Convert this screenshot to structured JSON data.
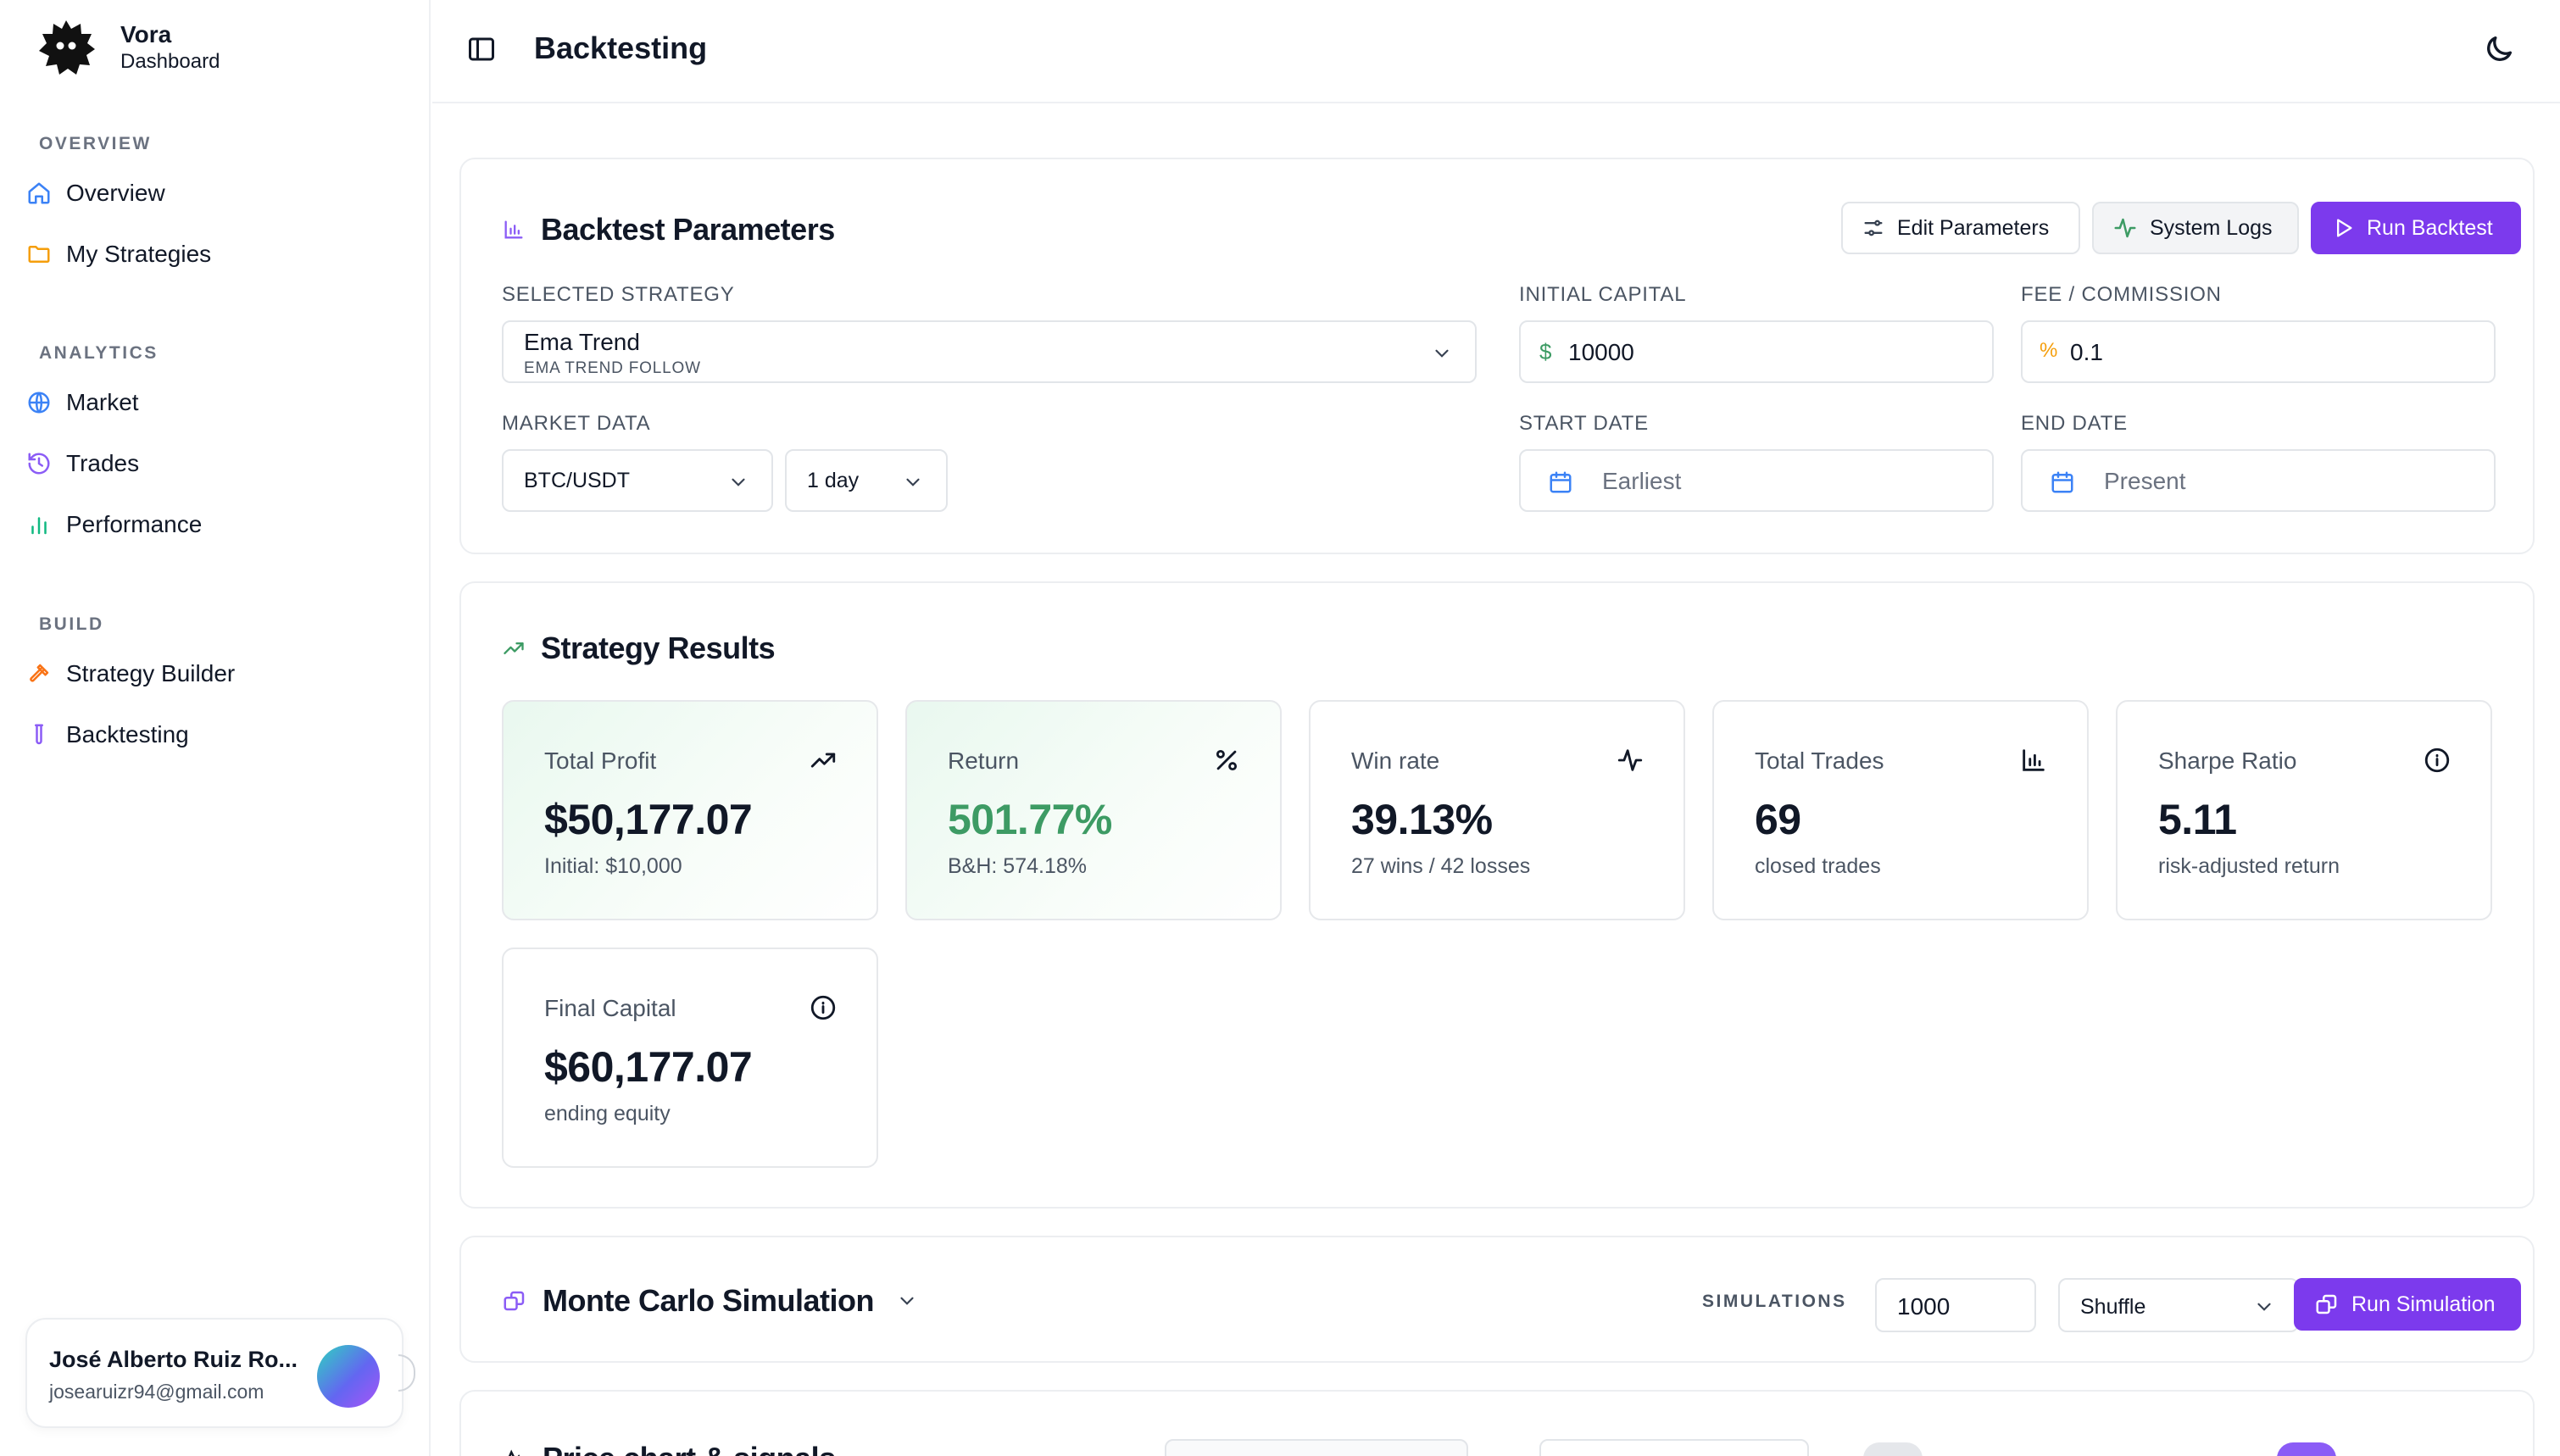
{
  "brand": {
    "name": "Vora",
    "subtitle": "Dashboard"
  },
  "sidebar": {
    "sections": [
      {
        "heading": "OVERVIEW",
        "items": [
          {
            "label": "Overview",
            "icon": "home-icon"
          },
          {
            "label": "My Strategies",
            "icon": "folder-icon"
          }
        ]
      },
      {
        "heading": "ANALYTICS",
        "items": [
          {
            "label": "Market",
            "icon": "globe-icon"
          },
          {
            "label": "Trades",
            "icon": "history-icon"
          },
          {
            "label": "Performance",
            "icon": "bar-chart-icon"
          }
        ]
      },
      {
        "heading": "BUILD",
        "items": [
          {
            "label": "Strategy Builder",
            "icon": "hammer-icon"
          },
          {
            "label": "Backtesting",
            "icon": "test-tube-icon"
          }
        ]
      }
    ],
    "user": {
      "name": "José Alberto Ruiz Ro...",
      "email": "josearuizr94@gmail.com"
    }
  },
  "header": {
    "title": "Backtesting"
  },
  "params": {
    "title": "Backtest Parameters",
    "edit_label": "Edit Parameters",
    "logs_label": "System Logs",
    "run_label": "Run Backtest",
    "strategy_label": "SELECTED STRATEGY",
    "strategy_name": "Ema Trend",
    "strategy_sub": "EMA TREND FOLLOW",
    "capital_label": "INITIAL CAPITAL",
    "capital_prefix": "$",
    "capital_value": "10000",
    "fee_label": "FEE / COMMISSION",
    "fee_prefix": "%",
    "fee_value": "0.1",
    "market_label": "MARKET DATA",
    "pair_value": "BTC/USDT",
    "interval_value": "1 day",
    "start_label": "START DATE",
    "start_placeholder": "Earliest",
    "end_label": "END DATE",
    "end_placeholder": "Present"
  },
  "results": {
    "title": "Strategy Results",
    "stats": [
      {
        "label": "Total Profit",
        "value": "$50,177.07",
        "sub": "Initial: $10,000",
        "icon": "trending-up-icon"
      },
      {
        "label": "Return",
        "value": "501.77%",
        "sub": "B&H: 574.18%",
        "icon": "percent-icon"
      },
      {
        "label": "Win rate",
        "value": "39.13%",
        "sub": "27 wins / 42 losses",
        "icon": "activity-icon"
      },
      {
        "label": "Total Trades",
        "value": "69",
        "sub": "closed trades",
        "icon": "bar-chart-icon"
      },
      {
        "label": "Sharpe Ratio",
        "value": "5.11",
        "sub": "risk-adjusted return",
        "icon": "info-icon"
      },
      {
        "label": "Final Capital",
        "value": "$60,177.07",
        "sub": "ending equity",
        "icon": "info-icon"
      }
    ]
  },
  "monte_carlo": {
    "title": "Monte Carlo Simulation",
    "sim_label": "SIMULATIONS",
    "sim_value": "1000",
    "method_value": "Shuffle",
    "run_label": "Run Simulation"
  },
  "price_chart": {
    "title": "Price chart & signals"
  },
  "colors": {
    "accent": "#7c3aed",
    "success": "#3d9b64",
    "border": "#e2e5e9",
    "text": "#111827",
    "muted": "#6b7280"
  }
}
